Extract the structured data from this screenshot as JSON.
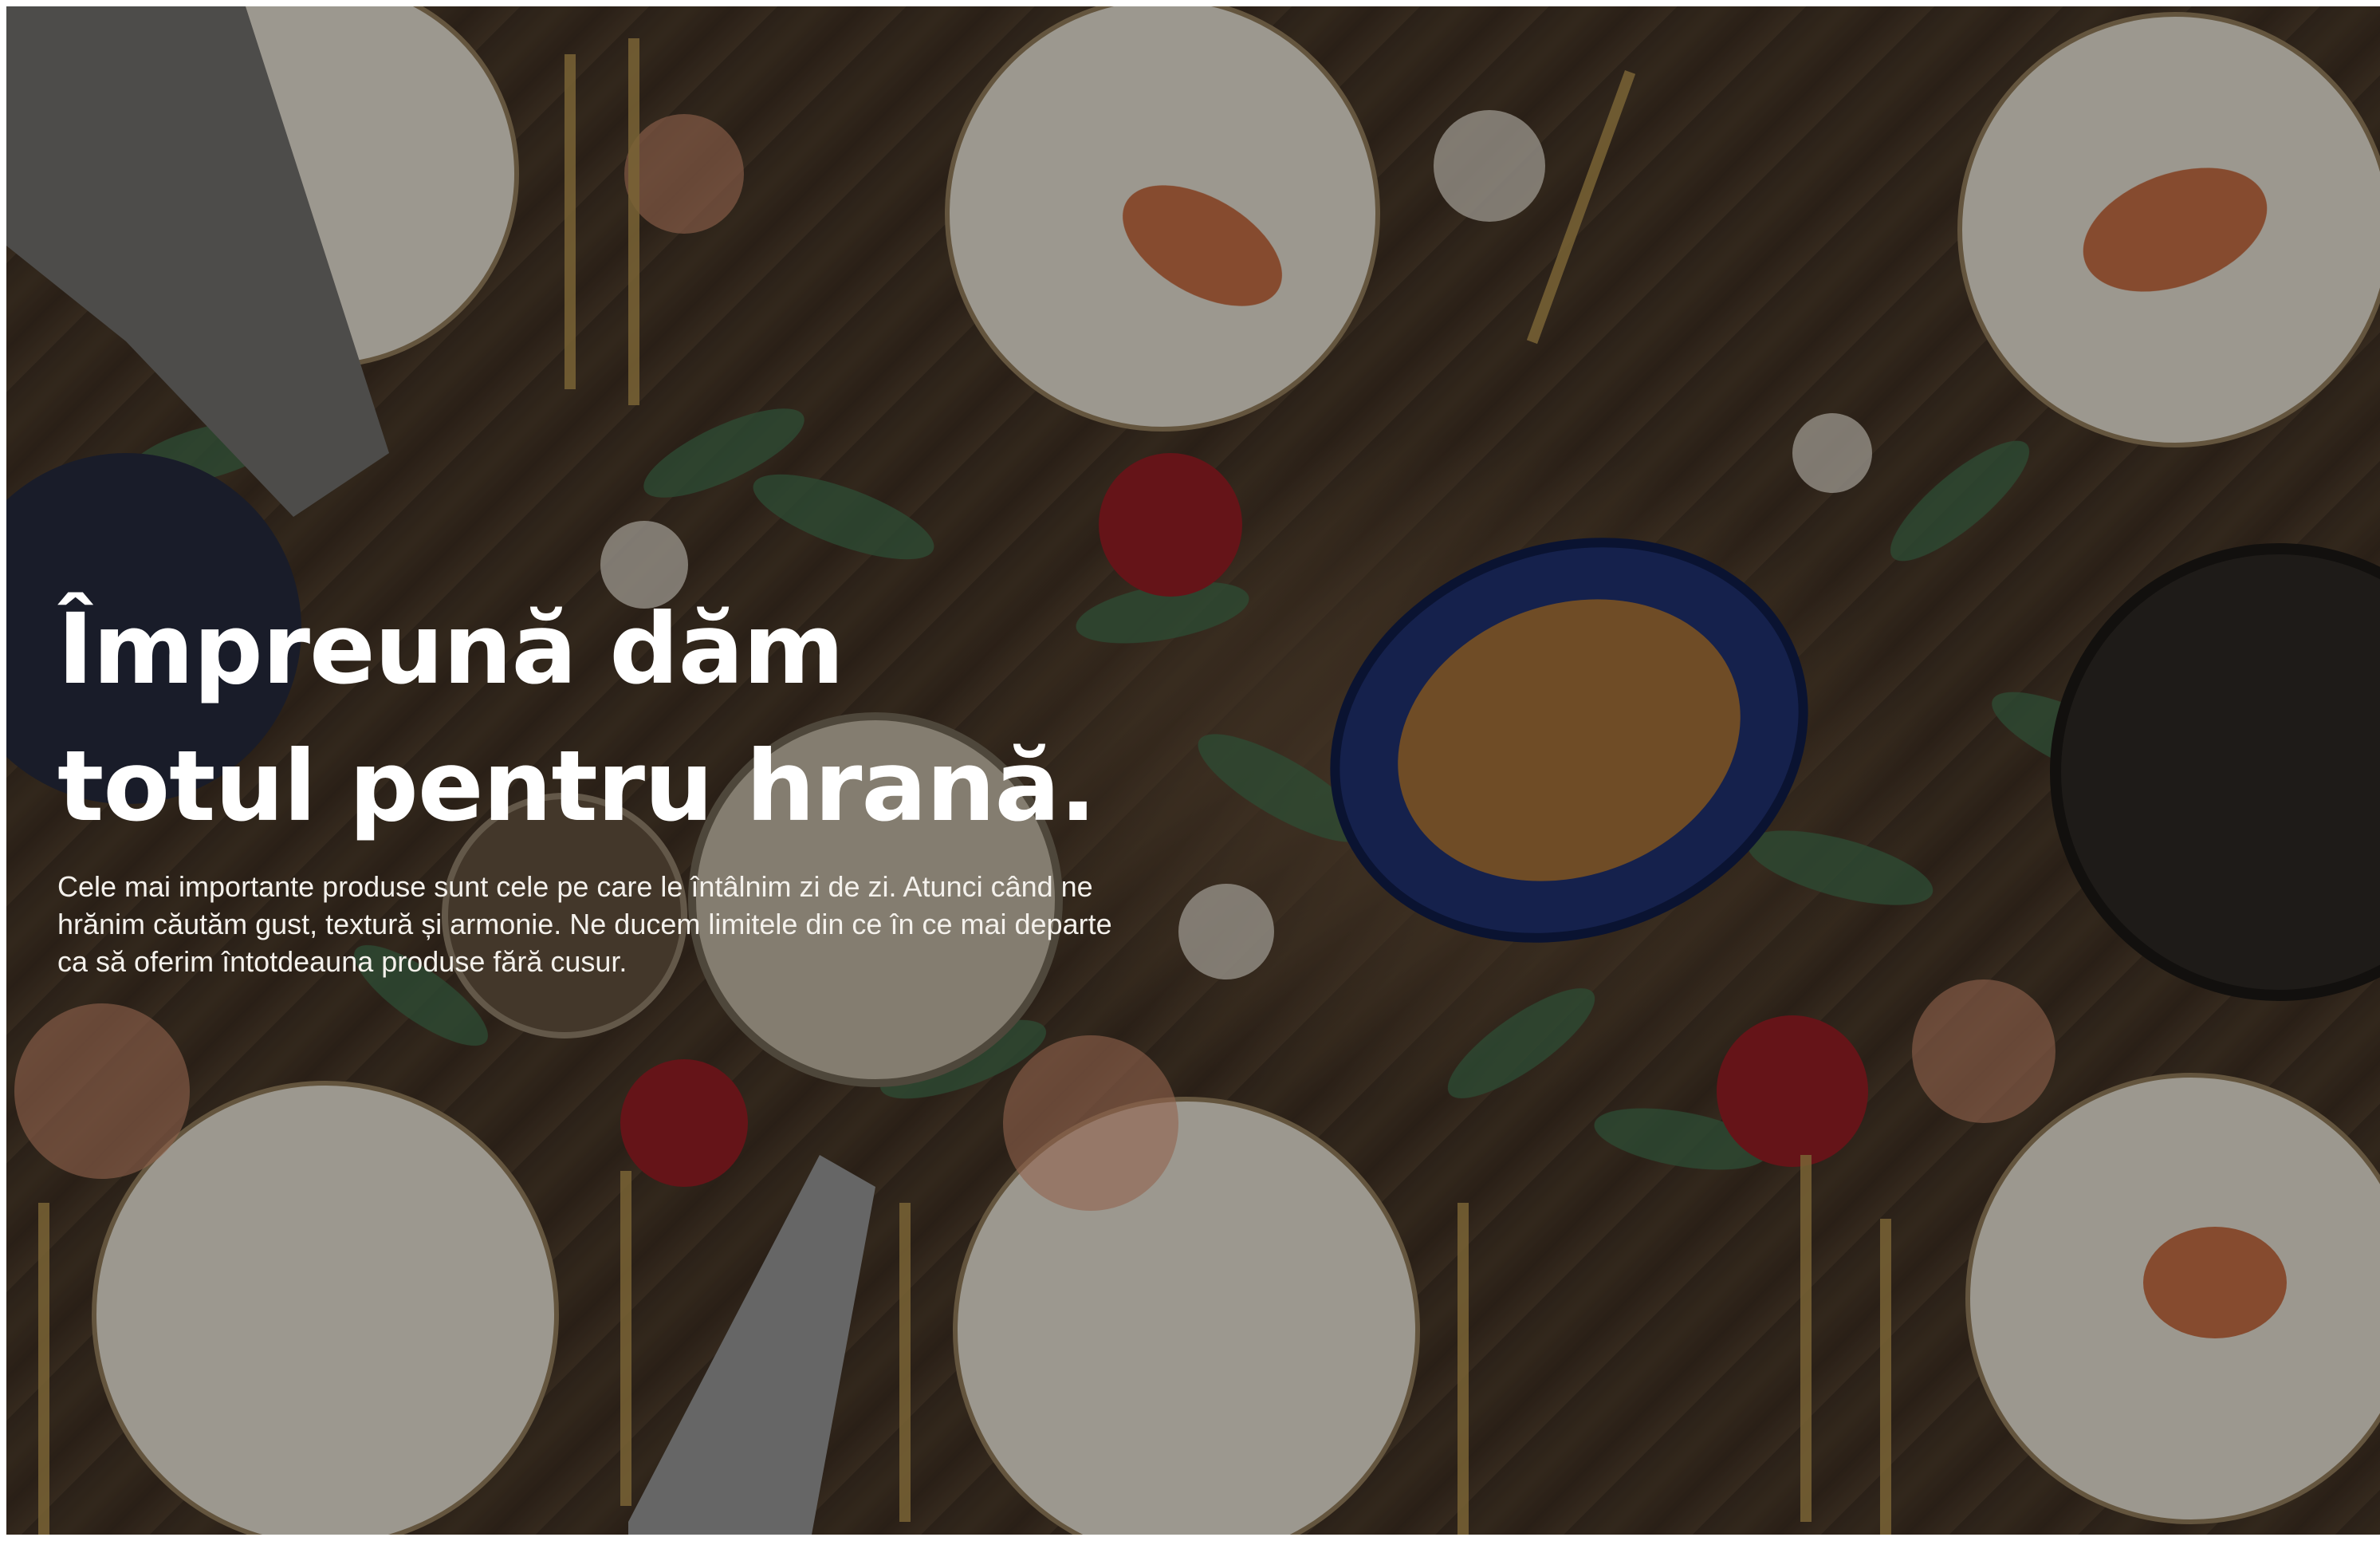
{
  "hero": {
    "headline_line1": "Împreună dăm",
    "headline_line2": "totul pentru hrană.",
    "description": "Cele mai importante produse sunt cele pe care le întâlnim zi de zi. Atunci când ne hrănim căutăm gust, textură și armonie. Ne ducem limitele din ce în ce mai departe ca să oferim întotdeauna produse fără cusur.",
    "background_image": "festive-dinner-table-photo",
    "colors": {
      "text": "#ffffff",
      "wood": "#3d3024",
      "plate": "#d9d3c7",
      "pomegranate": "#8c1c22",
      "leaf": "#3f6b4a"
    }
  }
}
